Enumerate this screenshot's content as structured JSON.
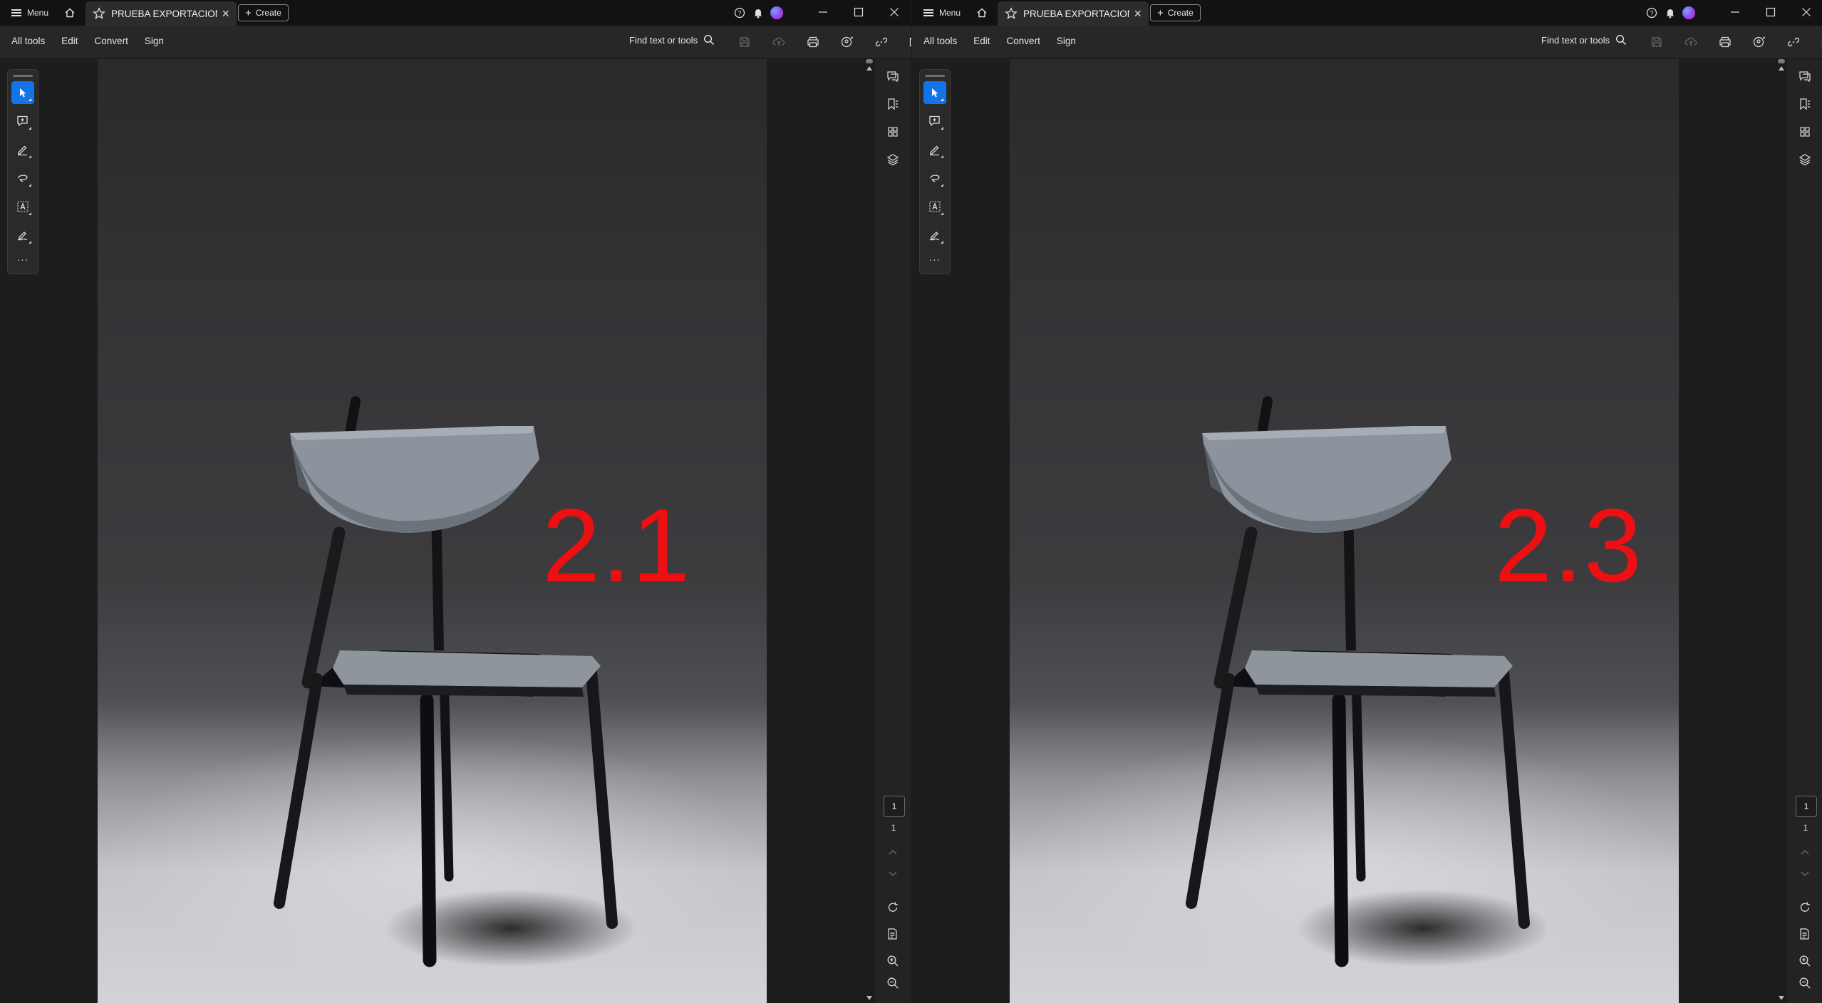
{
  "titlebar": {
    "menu_label": "Menu",
    "tab_title": "PRUEBA EXPORTACION...",
    "create_label": "Create"
  },
  "toolbar": {
    "nav": [
      "All tools",
      "Edit",
      "Convert",
      "Sign"
    ],
    "find_label": "Find text or tools"
  },
  "windows": [
    {
      "version_label": "2.1",
      "current_page": "1",
      "total_pages": "1"
    },
    {
      "version_label": "2.3",
      "current_page": "1",
      "total_pages": "1"
    }
  ],
  "icons": {
    "titlebar": [
      "menu-icon",
      "home-icon",
      "star-icon",
      "close-tab-icon",
      "plus-icon",
      "help-icon",
      "bell-icon",
      "avatar",
      "minimize-icon",
      "maximize-icon",
      "close-window-icon"
    ],
    "toolbar": [
      "search-icon",
      "save-icon",
      "upload-icon",
      "print-icon",
      "share-icon",
      "link-icon",
      "mail-icon"
    ],
    "left_tools": [
      "select-icon",
      "add-comment-icon",
      "highlight-icon",
      "draw-icon",
      "text-select-icon",
      "fill-sign-icon",
      "more-icon"
    ],
    "right_panel": [
      "comments-icon",
      "bookmarks-icon",
      "thumbnails-icon",
      "layers-icon",
      "rotate-icon",
      "page-extract-icon",
      "zoom-in-icon",
      "zoom-out-icon"
    ]
  },
  "colors": {
    "accent": "#1473e6",
    "version_label": "#ee0f12"
  }
}
